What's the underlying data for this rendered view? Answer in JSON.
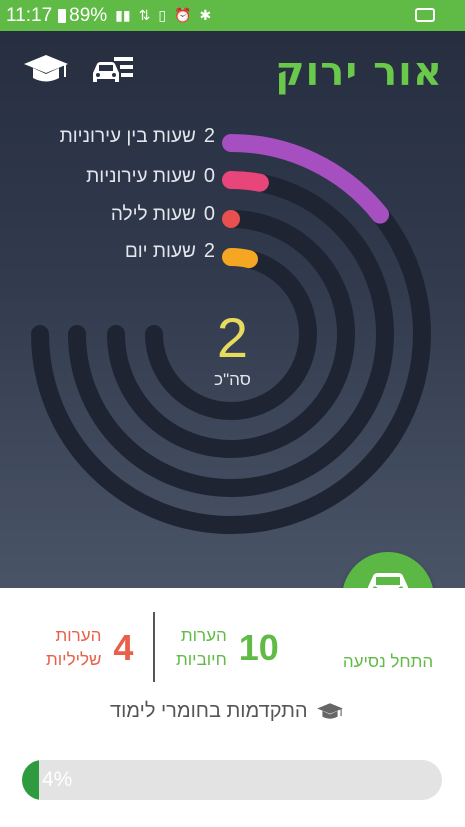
{
  "status_bar": {
    "time": "11:17",
    "battery": "89%"
  },
  "header": {
    "logo": "אור ירוק",
    "left_icons": [
      "graduation-cap-icon",
      "car-list-icon"
    ]
  },
  "hours": {
    "items": [
      {
        "label": "שעות בין עירוניות",
        "value": "2",
        "color": "#a64fc0",
        "fraction": 0.19
      },
      {
        "label": "שעות עירוניות",
        "value": "0",
        "color": "#e8467a",
        "fraction": 0.04
      },
      {
        "label": "שעות לילה",
        "value": "0",
        "color": "#e85050",
        "fraction": 0.0
      },
      {
        "label": "שעות יום",
        "value": "2",
        "color": "#f5a623",
        "fraction": 0.05
      }
    ],
    "total_value": "2",
    "total_label": "סה\"כ"
  },
  "start_drive": {
    "label": "התחל נסיעה",
    "icon": "car-key-icon",
    "color": "#5bb845"
  },
  "remarks": {
    "positive": {
      "value": "10",
      "label_line1": "הערות",
      "label_line2": "חיוביות",
      "color": "#5fbb46"
    },
    "negative": {
      "value": "4",
      "label_line1": "הערות",
      "label_line2": "שליליות",
      "color": "#e8604a"
    }
  },
  "study_progress": {
    "title": "התקדמות בחומרי לימוד",
    "icon": "graduation-cap-icon",
    "percent_text": "4%",
    "fraction": 0.04
  }
}
